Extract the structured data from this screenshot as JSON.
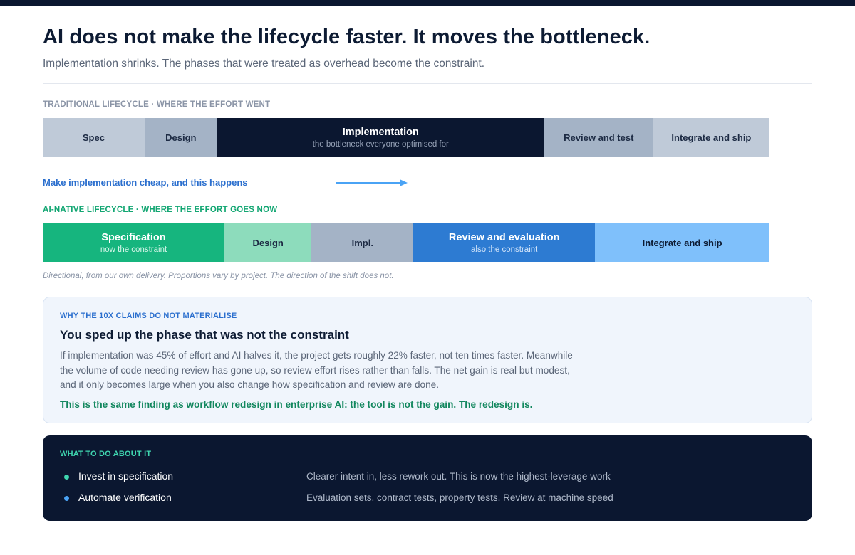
{
  "header": {
    "title": "AI does not make the lifecycle faster. It moves the bottleneck.",
    "subtitle": "Implementation shrinks. The phases that were treated as overhead become the constraint."
  },
  "traditional": {
    "label": "TRADITIONAL LIFECYCLE · WHERE THE EFFORT WENT",
    "segments": [
      {
        "label": "Spec",
        "sub": "",
        "share": 0.14,
        "bg": "#bfcad8",
        "fg": "#1d2b44"
      },
      {
        "label": "Design",
        "sub": "",
        "share": 0.1,
        "bg": "#a4b3c6",
        "fg": "#1d2b44"
      },
      {
        "label": "Implementation",
        "sub": "the bottleneck everyone optimised for",
        "share": 0.45,
        "bg": "#0b1730",
        "fg": "#ffffff",
        "subfg": "#97a3b8"
      },
      {
        "label": "Review and test",
        "sub": "",
        "share": 0.15,
        "bg": "#a4b3c6",
        "fg": "#1d2b44"
      },
      {
        "label": "Integrate and ship",
        "sub": "",
        "share": 0.16,
        "bg": "#bfcad8",
        "fg": "#1d2b44"
      }
    ]
  },
  "transition": {
    "text": "Make implementation cheap, and this happens"
  },
  "ai_native": {
    "label": "AI-NATIVE LIFECYCLE · WHERE THE EFFORT GOES NOW",
    "segments": [
      {
        "label": "Specification",
        "sub": "now the constraint",
        "share": 0.25,
        "bg": "#16b57e",
        "fg": "#ffffff",
        "subfg": "#d6f5e9"
      },
      {
        "label": "Design",
        "sub": "",
        "share": 0.12,
        "bg": "#8ddcbc",
        "fg": "#1d2b44"
      },
      {
        "label": "Impl.",
        "sub": "",
        "share": 0.14,
        "bg": "#a4b3c6",
        "fg": "#1d2b44"
      },
      {
        "label": "Review and evaluation",
        "sub": "also the constraint",
        "share": 0.25,
        "bg": "#2d7bd2",
        "fg": "#ffffff",
        "subfg": "#d3e5fa"
      },
      {
        "label": "Integrate and ship",
        "sub": "",
        "share": 0.24,
        "bg": "#7fc0fb",
        "fg": "#0d1b33"
      }
    ]
  },
  "note": "Directional, from our own delivery. Proportions vary by project. The direction of the shift does not.",
  "callout": {
    "label": "WHY THE 10X CLAIMS DO NOT MATERIALISE",
    "title": "You sped up the phase that was not the constraint",
    "body_lines": [
      "If implementation was 45% of effort and AI halves it, the project gets roughly 22% faster, not ten times faster. Meanwhile",
      "the volume of code needing review has gone up, so review effort rises rather than falls. The net gain is real but modest,",
      "and it only becomes large when you also change how specification and review are done."
    ],
    "highlight": "This is the same finding as workflow redesign in enterprise AI: the tool is not the gain. The redesign is."
  },
  "todo": {
    "label": "WHAT TO DO ABOUT IT",
    "items": [
      {
        "name": "Invest in specification",
        "desc": "Clearer intent in, less rework out. This is now the highest-leverage work",
        "dot_color": "#3fd6b0"
      },
      {
        "name": "Automate verification",
        "desc": "Evaluation sets, contract tests, property tests. Review at machine speed",
        "dot_color": "#4aa3f5"
      }
    ]
  },
  "colors": {
    "navy": "#0b1730",
    "accent_blue": "#2b6fce",
    "accent_green": "#12a672",
    "muted_text": "#5b6678"
  }
}
